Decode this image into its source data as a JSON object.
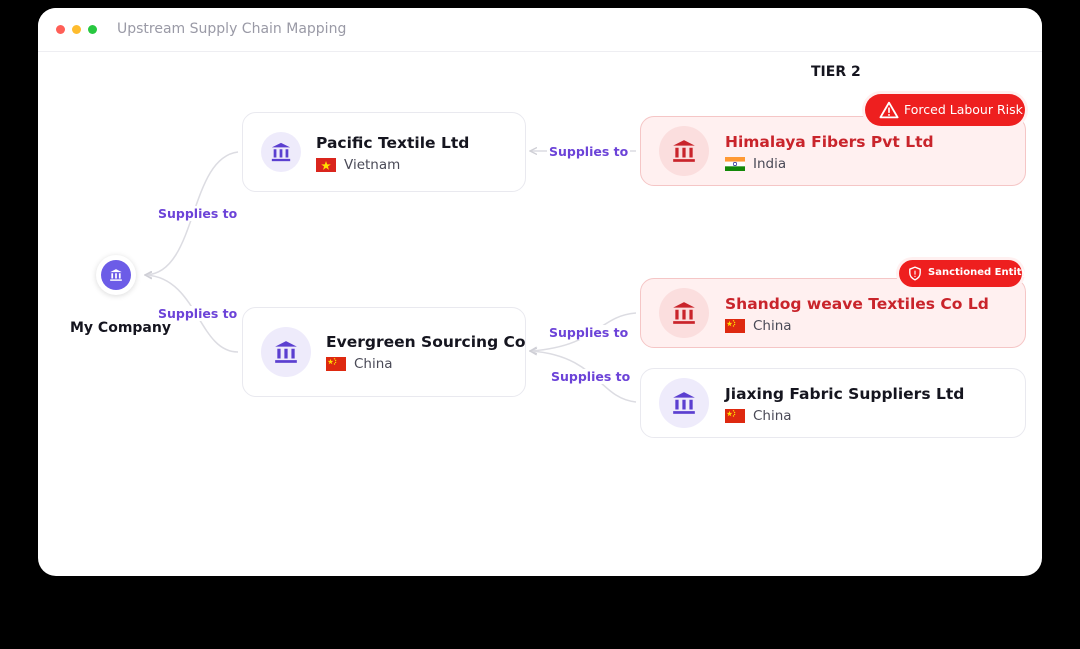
{
  "window": {
    "title": "Upstream Supply Chain Mapping"
  },
  "tier_label": "TIER 2",
  "root": {
    "label": "My Company"
  },
  "link_label": "Supplies to",
  "tier1": [
    {
      "name": "Pacific Textile Ltd",
      "country": "Vietnam",
      "flag": "vietnam"
    },
    {
      "name": "Evergreen Sourcing Co",
      "country": "China",
      "flag": "china"
    }
  ],
  "tier2": [
    {
      "name": "Himalaya Fibers Pvt Ltd",
      "country": "India",
      "flag": "india",
      "risk": "Forced Labour Risk"
    },
    {
      "name": "Shandog weave Textiles Co Ld",
      "country": "China",
      "flag": "china",
      "risk": "Sanctioned Entity"
    },
    {
      "name": "Jiaxing Fabric Suppliers Ltd",
      "country": "China",
      "flag": "china",
      "risk": ""
    }
  ],
  "colors": {
    "accent": "#6c43d8",
    "risk_red": "#ee1f1f",
    "risk_text": "#c9242b",
    "root_fill": "#6c5ce7"
  },
  "icons": {
    "company": "bank-building-icon",
    "forced_labour": "warning-triangle-icon",
    "sanctioned": "shield-alert-icon"
  }
}
